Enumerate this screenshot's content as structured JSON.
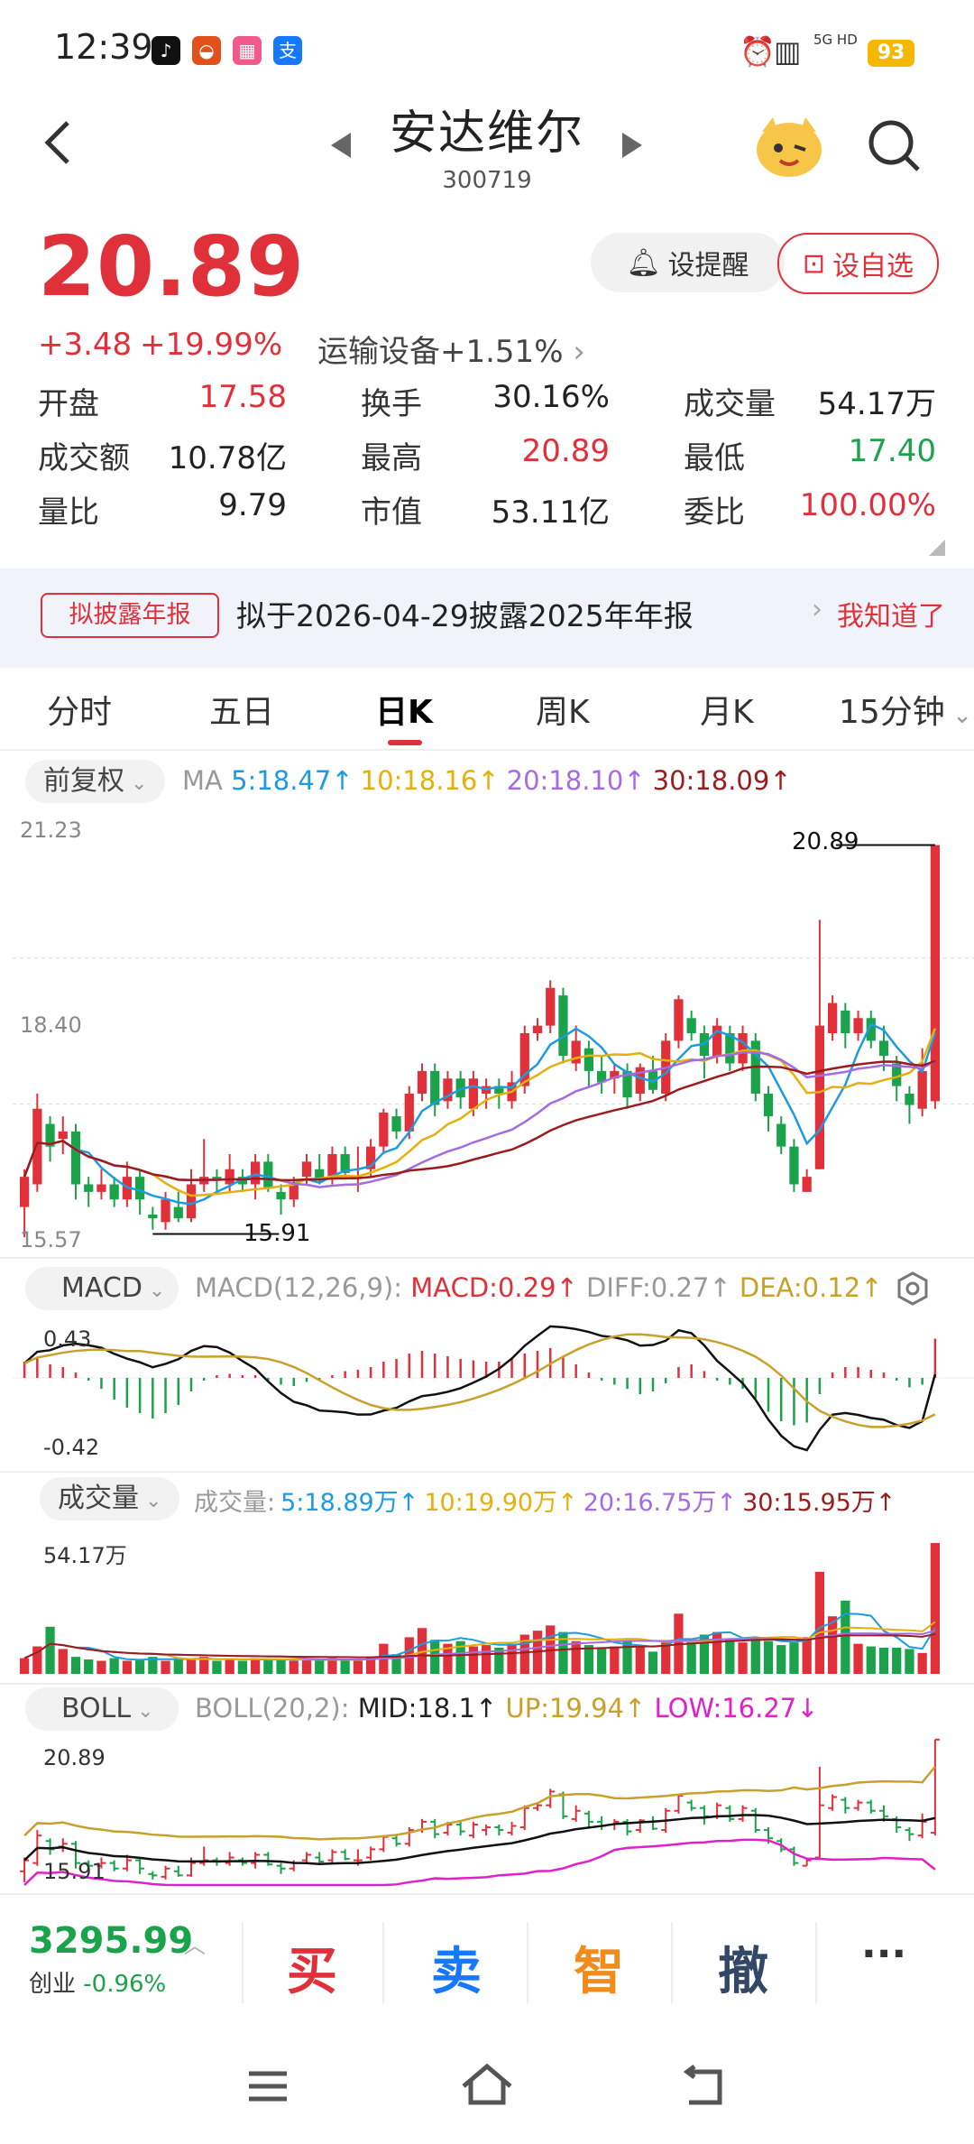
{
  "status_bar": {
    "time": "12:39",
    "battery": "93",
    "network": "5G HD"
  },
  "stock": {
    "name": "安达维尔",
    "code": "300719",
    "price": "20.89",
    "change": "+3.48",
    "change_pct": "+19.99%",
    "sector": "运输设备",
    "sector_pct": "+1.51%"
  },
  "actions": {
    "alert": "设提醒",
    "favorite": "设自选"
  },
  "stats": [
    {
      "label": "开盘",
      "value": "17.58",
      "color": "red"
    },
    {
      "label": "换手",
      "value": "30.16%",
      "color": "black"
    },
    {
      "label": "成交量",
      "value": "54.17万",
      "color": "black"
    },
    {
      "label": "成交额",
      "value": "10.78亿",
      "color": "black"
    },
    {
      "label": "最高",
      "value": "20.89",
      "color": "red"
    },
    {
      "label": "最低",
      "value": "17.40",
      "color": "green"
    },
    {
      "label": "量比",
      "value": "9.79",
      "color": "black"
    },
    {
      "label": "市值",
      "value": "53.11亿",
      "color": "black"
    },
    {
      "label": "委比",
      "value": "100.00%",
      "color": "red"
    }
  ],
  "notice": {
    "tag": "拟披露年报",
    "text": "拟于2026-04-29披露2025年年报",
    "dismiss": "我知道了"
  },
  "tabs": [
    "分时",
    "五日",
    "日K",
    "周K",
    "月K",
    "15分钟"
  ],
  "active_tab": "日K",
  "kline": {
    "adjust": "前复权",
    "ma_label": "MA",
    "ma": [
      {
        "text": "5:18.47↑",
        "color": "#1e9be0"
      },
      {
        "text": "10:18.16↑",
        "color": "#e3b00c"
      },
      {
        "text": "20:18.10↑",
        "color": "#a56be0"
      },
      {
        "text": "30:18.09↑",
        "color": "#9b1c1c"
      }
    ],
    "y_top": "21.23",
    "y_mid": "18.40",
    "y_bottom": "15.57",
    "high_label": "20.89",
    "low_label": "15.91"
  },
  "macd": {
    "selector": "MACD",
    "params": "MACD(12,26,9):",
    "macd": "MACD:0.29↑",
    "diff": "DIFF:0.27↑",
    "dea": "DEA:0.12↑",
    "y_top": "0.43",
    "y_bottom": "-0.42"
  },
  "volume": {
    "selector": "成交量",
    "prefix": "成交量:",
    "ma": [
      {
        "text": "5:18.89万↑",
        "color": "#1e9be0"
      },
      {
        "text": "10:19.90万↑",
        "color": "#e3b00c"
      },
      {
        "text": "20:16.75万↑",
        "color": "#a56be0"
      },
      {
        "text": "30:15.95万↑",
        "color": "#9b1c1c"
      }
    ],
    "y_top": "54.17万"
  },
  "boll": {
    "selector": "BOLL",
    "params": "BOLL(20,2):",
    "mid": "MID:18.1↑",
    "up": "UP:19.94↑",
    "low": "LOW:16.27↓",
    "y_top": "20.89",
    "y_bottom": "15.91"
  },
  "index": {
    "value": "3295.99",
    "name": "创业",
    "change": "-0.96%"
  },
  "trade_buttons": [
    "买",
    "卖",
    "智",
    "撤"
  ],
  "more": "···",
  "candles": [
    [
      16.1,
      16.5,
      15.7,
      16.6
    ],
    [
      16.4,
      17.4,
      16.3,
      17.6
    ],
    [
      17.2,
      16.9,
      16.7,
      17.3
    ],
    [
      17.0,
      17.1,
      16.8,
      17.3
    ],
    [
      17.1,
      16.4,
      16.2,
      17.2
    ],
    [
      16.4,
      16.3,
      16.1,
      16.5
    ],
    [
      16.3,
      16.4,
      16.2,
      16.6
    ],
    [
      16.4,
      16.2,
      16.1,
      16.5
    ],
    [
      16.2,
      16.5,
      16.1,
      16.7
    ],
    [
      16.5,
      16.2,
      16.0,
      16.6
    ],
    [
      16.0,
      15.95,
      15.8,
      16.1
    ],
    [
      15.9,
      16.2,
      15.8,
      16.3
    ],
    [
      16.1,
      15.95,
      15.9,
      16.3
    ],
    [
      15.95,
      16.4,
      15.9,
      16.6
    ],
    [
      16.4,
      16.5,
      16.3,
      17.0
    ],
    [
      16.5,
      16.45,
      16.3,
      16.6
    ],
    [
      16.4,
      16.6,
      16.3,
      16.8
    ],
    [
      16.5,
      16.4,
      16.3,
      16.6
    ],
    [
      16.4,
      16.7,
      16.2,
      16.8
    ],
    [
      16.7,
      16.35,
      16.3,
      16.8
    ],
    [
      16.3,
      16.2,
      16.0,
      16.4
    ],
    [
      16.2,
      16.4,
      16.1,
      16.5
    ],
    [
      16.5,
      16.7,
      16.4,
      16.8
    ],
    [
      16.6,
      16.45,
      16.4,
      16.8
    ],
    [
      16.5,
      16.8,
      16.4,
      16.9
    ],
    [
      16.8,
      16.55,
      16.5,
      16.9
    ],
    [
      16.5,
      16.5,
      16.3,
      16.9
    ],
    [
      16.6,
      16.9,
      16.5,
      17.0
    ],
    [
      16.9,
      17.35,
      16.8,
      17.4
    ],
    [
      17.3,
      17.1,
      17.0,
      17.4
    ],
    [
      17.1,
      17.6,
      17.0,
      17.7
    ],
    [
      17.6,
      17.9,
      17.5,
      18.0
    ],
    [
      17.9,
      17.45,
      17.3,
      18.0
    ],
    [
      17.5,
      17.8,
      17.4,
      17.9
    ],
    [
      17.8,
      17.55,
      17.4,
      17.9
    ],
    [
      17.4,
      17.8,
      17.3,
      17.9
    ],
    [
      17.6,
      17.7,
      17.4,
      17.8
    ],
    [
      17.7,
      17.6,
      17.4,
      17.8
    ],
    [
      17.5,
      17.75,
      17.4,
      17.9
    ],
    [
      17.7,
      18.4,
      17.6,
      18.5
    ],
    [
      18.4,
      18.5,
      18.3,
      18.6
    ],
    [
      18.5,
      19.0,
      18.4,
      19.1
    ],
    [
      18.9,
      18.1,
      18.0,
      19.0
    ],
    [
      18.0,
      18.3,
      17.9,
      18.5
    ],
    [
      18.2,
      17.9,
      17.7,
      18.3
    ],
    [
      17.9,
      17.75,
      17.6,
      18.1
    ],
    [
      17.8,
      17.9,
      17.6,
      18.0
    ],
    [
      17.9,
      17.55,
      17.4,
      18.0
    ],
    [
      17.6,
      17.95,
      17.5,
      18.0
    ],
    [
      17.9,
      17.65,
      17.6,
      18.1
    ],
    [
      17.6,
      18.3,
      17.5,
      18.4
    ],
    [
      18.3,
      18.85,
      18.2,
      18.9
    ],
    [
      18.6,
      18.4,
      18.3,
      18.7
    ],
    [
      18.4,
      18.1,
      17.8,
      18.5
    ],
    [
      18.1,
      18.5,
      18.0,
      18.6
    ],
    [
      18.4,
      18.0,
      17.9,
      18.5
    ],
    [
      18.0,
      18.4,
      17.9,
      18.5
    ],
    [
      18.3,
      17.6,
      17.5,
      18.4
    ],
    [
      17.6,
      17.3,
      17.1,
      17.7
    ],
    [
      17.2,
      16.9,
      16.8,
      17.3
    ],
    [
      16.9,
      16.4,
      16.3,
      17.0
    ],
    [
      16.3,
      16.5,
      16.3,
      16.6
    ],
    [
      16.6,
      18.5,
      16.6,
      19.9
    ],
    [
      18.4,
      18.8,
      18.3,
      18.9
    ],
    [
      18.7,
      18.4,
      18.2,
      18.8
    ],
    [
      18.4,
      18.6,
      18.3,
      18.7
    ],
    [
      18.6,
      18.3,
      18.2,
      18.7
    ],
    [
      18.3,
      18.1,
      17.9,
      18.5
    ],
    [
      18.0,
      17.7,
      17.5,
      18.1
    ],
    [
      17.6,
      17.45,
      17.2,
      17.7
    ],
    [
      17.4,
      17.9,
      17.3,
      18.2
    ],
    [
      17.5,
      20.89,
      17.4,
      20.89
    ]
  ],
  "macd_hist": [
    0.12,
    0.15,
    0.1,
    0.08,
    0.04,
    -0.02,
    -0.08,
    -0.16,
    -0.22,
    -0.26,
    -0.3,
    -0.26,
    -0.2,
    -0.1,
    -0.02,
    0.02,
    0.03,
    0.02,
    0.02,
    -0.02,
    -0.05,
    -0.06,
    -0.03,
    -0.02,
    0.02,
    0.05,
    0.06,
    0.08,
    0.12,
    0.14,
    0.18,
    0.2,
    0.18,
    0.16,
    0.14,
    0.13,
    0.12,
    0.12,
    0.14,
    0.18,
    0.2,
    0.22,
    0.16,
    0.1,
    0.04,
    -0.02,
    -0.05,
    -0.08,
    -0.12,
    -0.1,
    -0.04,
    0.08,
    0.1,
    0.05,
    -0.02,
    -0.05,
    -0.08,
    -0.15,
    -0.25,
    -0.32,
    -0.35,
    -0.33,
    -0.12,
    0.04,
    0.08,
    0.08,
    0.06,
    0.04,
    -0.02,
    -0.07,
    -0.05,
    0.29
  ],
  "volumes": [
    1.2,
    2.1,
    3.6,
    1.9,
    1.3,
    1.1,
    1.0,
    1.2,
    1.0,
    1.1,
    1.3,
    1.0,
    1.2,
    1.1,
    1.3,
    1.0,
    1.1,
    1.0,
    1.2,
    1.1,
    1.1,
    1.0,
    1.1,
    1.0,
    1.2,
    1.1,
    1.0,
    1.3,
    2.3,
    1.5,
    2.8,
    3.5,
    2.6,
    2.3,
    2.5,
    2.1,
    2.2,
    2.0,
    2.3,
    3.0,
    3.3,
    3.7,
    3.2,
    2.5,
    2.2,
    2.0,
    2.1,
    2.5,
    2.1,
    1.7,
    2.4,
    4.6,
    2.5,
    3.0,
    3.2,
    2.6,
    2.4,
    2.8,
    2.5,
    2.2,
    2.4,
    2.8,
    7.8,
    4.4,
    5.6,
    2.3,
    2.1,
    2.0,
    2.0,
    1.9,
    1.6,
    10.0
  ]
}
